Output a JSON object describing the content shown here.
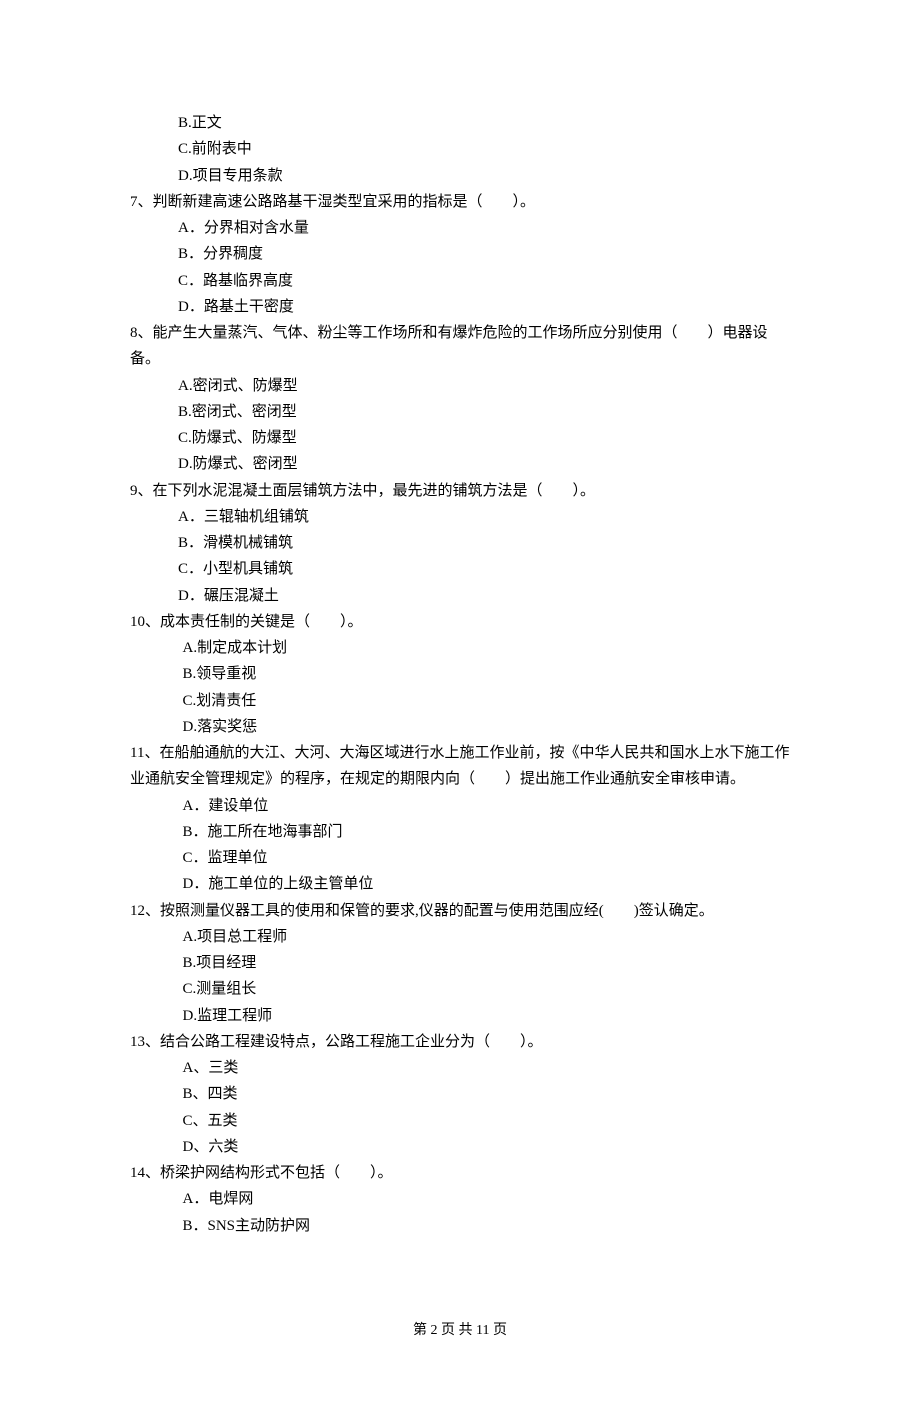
{
  "lines": [
    {
      "cls": "option",
      "text": "B.正文"
    },
    {
      "cls": "option",
      "text": "C.前附表中"
    },
    {
      "cls": "option",
      "text": "D.项目专用条款"
    },
    {
      "cls": "question",
      "text": "7、判断新建高速公路路基干湿类型宜采用的指标是（　　）。"
    },
    {
      "cls": "option",
      "text": "A．分界相对含水量"
    },
    {
      "cls": "option",
      "text": "B．分界稠度"
    },
    {
      "cls": "option",
      "text": "C．路基临界高度"
    },
    {
      "cls": "option",
      "text": "D．路基土干密度"
    },
    {
      "cls": "question",
      "text": "8、能产生大量蒸汽、气体、粉尘等工作场所和有爆炸危险的工作场所应分别使用（　　）电器设备。"
    },
    {
      "cls": "option",
      "text": "A.密闭式、防爆型"
    },
    {
      "cls": "option",
      "text": "B.密闭式、密闭型"
    },
    {
      "cls": "option",
      "text": "C.防爆式、防爆型"
    },
    {
      "cls": "option",
      "text": "D.防爆式、密闭型"
    },
    {
      "cls": "question",
      "text": "9、在下列水泥混凝土面层铺筑方法中，最先进的铺筑方法是（　　）。"
    },
    {
      "cls": "option",
      "text": "A．三辊轴机组铺筑"
    },
    {
      "cls": "option",
      "text": "B．滑模机械铺筑"
    },
    {
      "cls": "option",
      "text": "C．小型机具铺筑"
    },
    {
      "cls": "option",
      "text": "D．碾压混凝土"
    },
    {
      "cls": "question",
      "text": "10、成本责任制的关键是（　　）。"
    },
    {
      "cls": "option-wide",
      "text": "A.制定成本计划"
    },
    {
      "cls": "option-wide",
      "text": "B.领导重视"
    },
    {
      "cls": "option-wide",
      "text": "C.划清责任"
    },
    {
      "cls": "option-wide",
      "text": "D.落实奖惩"
    },
    {
      "cls": "question",
      "text": "11、在船舶通航的大江、大河、大海区域进行水上施工作业前，按《中华人民共和国水上水下施工作业通航安全管理规定》的程序，在规定的期限内向（　　）提出施工作业通航安全审核申请。"
    },
    {
      "cls": "option-wide",
      "text": "A．建设单位"
    },
    {
      "cls": "option-wide",
      "text": "B．施工所在地海事部门"
    },
    {
      "cls": "option-wide",
      "text": "C．监理单位"
    },
    {
      "cls": "option-wide",
      "text": "D．施工单位的上级主管单位"
    },
    {
      "cls": "question",
      "text": "12、按照测量仪器工具的使用和保管的要求,仪器的配置与使用范围应经(　　)签认确定。"
    },
    {
      "cls": "option-wide",
      "text": "A.项目总工程师"
    },
    {
      "cls": "option-wide",
      "text": "B.项目经理"
    },
    {
      "cls": "option-wide",
      "text": "C.测量组长"
    },
    {
      "cls": "option-wide",
      "text": "D.监理工程师"
    },
    {
      "cls": "question",
      "text": "13、结合公路工程建设特点，公路工程施工企业分为（　　）。"
    },
    {
      "cls": "option-wide",
      "text": "A、三类"
    },
    {
      "cls": "option-wide",
      "text": "B、四类"
    },
    {
      "cls": "option-wide",
      "text": "C、五类"
    },
    {
      "cls": "option-wide",
      "text": "D、六类"
    },
    {
      "cls": "question",
      "text": "14、桥梁护网结构形式不包括（　　）。"
    },
    {
      "cls": "option-wide",
      "text": "A．电焊网"
    },
    {
      "cls": "option-wide",
      "text": "B．SNS主动防护网"
    }
  ],
  "footer": "第 2 页 共 11 页"
}
